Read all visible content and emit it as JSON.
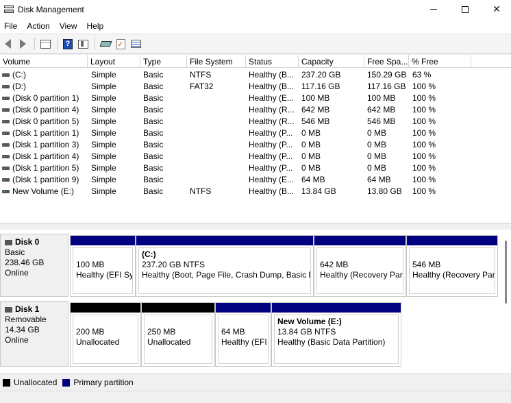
{
  "window": {
    "title": "Disk Management"
  },
  "menu": [
    "File",
    "Action",
    "View",
    "Help"
  ],
  "toolbar": {
    "icons": [
      "back-arrow-icon",
      "forward-arrow-icon",
      "properties-grid-icon",
      "help-icon",
      "show-hide-pane-icon",
      "connect-disk-icon",
      "check-icon",
      "list-view-icon"
    ]
  },
  "columns": [
    "Volume",
    "Layout",
    "Type",
    "File System",
    "Status",
    "Capacity",
    "Free Spa...",
    "% Free"
  ],
  "volumes": [
    {
      "volume": "(C:)",
      "layout": "Simple",
      "type": "Basic",
      "fs": "NTFS",
      "status": "Healthy (B...",
      "capacity": "237.20 GB",
      "free": "150.29 GB",
      "pct": "63 %"
    },
    {
      "volume": "(D:)",
      "layout": "Simple",
      "type": "Basic",
      "fs": "FAT32",
      "status": "Healthy (B...",
      "capacity": "117.16 GB",
      "free": "117.16 GB",
      "pct": "100 %"
    },
    {
      "volume": "(Disk 0 partition 1)",
      "layout": "Simple",
      "type": "Basic",
      "fs": "",
      "status": "Healthy (E...",
      "capacity": "100 MB",
      "free": "100 MB",
      "pct": "100 %"
    },
    {
      "volume": "(Disk 0 partition 4)",
      "layout": "Simple",
      "type": "Basic",
      "fs": "",
      "status": "Healthy (R...",
      "capacity": "642 MB",
      "free": "642 MB",
      "pct": "100 %"
    },
    {
      "volume": "(Disk 0 partition 5)",
      "layout": "Simple",
      "type": "Basic",
      "fs": "",
      "status": "Healthy (R...",
      "capacity": "546 MB",
      "free": "546 MB",
      "pct": "100 %"
    },
    {
      "volume": "(Disk 1 partition 1)",
      "layout": "Simple",
      "type": "Basic",
      "fs": "",
      "status": "Healthy (P...",
      "capacity": "0 MB",
      "free": "0 MB",
      "pct": "100 %"
    },
    {
      "volume": "(Disk 1 partition 3)",
      "layout": "Simple",
      "type": "Basic",
      "fs": "",
      "status": "Healthy (P...",
      "capacity": "0 MB",
      "free": "0 MB",
      "pct": "100 %"
    },
    {
      "volume": "(Disk 1 partition 4)",
      "layout": "Simple",
      "type": "Basic",
      "fs": "",
      "status": "Healthy (P...",
      "capacity": "0 MB",
      "free": "0 MB",
      "pct": "100 %"
    },
    {
      "volume": "(Disk 1 partition 5)",
      "layout": "Simple",
      "type": "Basic",
      "fs": "",
      "status": "Healthy (P...",
      "capacity": "0 MB",
      "free": "0 MB",
      "pct": "100 %"
    },
    {
      "volume": "(Disk 1 partition 9)",
      "layout": "Simple",
      "type": "Basic",
      "fs": "",
      "status": "Healthy (E...",
      "capacity": "64 MB",
      "free": "64 MB",
      "pct": "100 %"
    },
    {
      "volume": "New Volume (E:)",
      "layout": "Simple",
      "type": "Basic",
      "fs": "NTFS",
      "status": "Healthy (B...",
      "capacity": "13.84 GB",
      "free": "13.80 GB",
      "pct": "100 %"
    }
  ],
  "disks": [
    {
      "name": "Disk 0",
      "kind": "Basic",
      "size": "238.46 GB",
      "state": "Online",
      "partitions": [
        {
          "bar": "primary",
          "title": "",
          "line1": "100 MB",
          "line2": "Healthy (EFI Sys"
        },
        {
          "bar": "primary",
          "title": "(C:)",
          "line1": "237.20 GB NTFS",
          "line2": "Healthy (Boot, Page File, Crash Dump, Basic Da"
        },
        {
          "bar": "primary",
          "title": "",
          "line1": "642 MB",
          "line2": "Healthy (Recovery Part"
        },
        {
          "bar": "primary",
          "title": "",
          "line1": "546 MB",
          "line2": "Healthy (Recovery Part"
        }
      ]
    },
    {
      "name": "Disk 1",
      "kind": "Removable",
      "size": "14.34 GB",
      "state": "Online",
      "partitions": [
        {
          "bar": "unalloc",
          "title": "",
          "line1": "200 MB",
          "line2": "Unallocated"
        },
        {
          "bar": "unalloc",
          "title": "",
          "line1": "250 MB",
          "line2": "Unallocated"
        },
        {
          "bar": "primary",
          "title": "",
          "line1": "64 MB",
          "line2": "Healthy (EFI"
        },
        {
          "bar": "primary",
          "title": "New Volume  (E:)",
          "line1": "13.84 GB NTFS",
          "line2": "Healthy (Basic Data Partition)"
        }
      ]
    }
  ],
  "legend": [
    {
      "label": "Unallocated",
      "color": "#000000"
    },
    {
      "label": "Primary partition",
      "color": "#000080"
    }
  ]
}
